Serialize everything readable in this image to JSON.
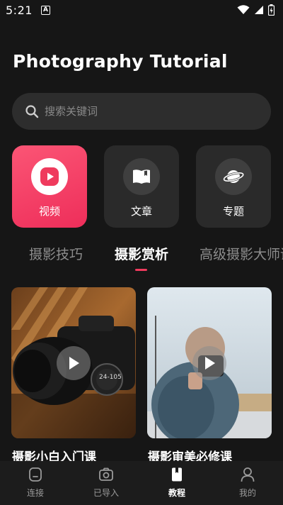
{
  "status": {
    "time": "5:21",
    "notif_letter": "A"
  },
  "header": {
    "title": "Photography Tutorial"
  },
  "search": {
    "placeholder": "搜索关键词"
  },
  "categories": [
    {
      "label": "视频",
      "icon": "play-circle-icon",
      "active": true
    },
    {
      "label": "文章",
      "icon": "book-icon",
      "active": false
    },
    {
      "label": "专题",
      "icon": "planet-icon",
      "active": false
    }
  ],
  "tabs": [
    {
      "label": "摄影技巧",
      "active": false
    },
    {
      "label": "摄影赏析",
      "active": true
    },
    {
      "label": "高级摄影大师课",
      "active": false
    }
  ],
  "cards": [
    {
      "title": "摄影小白入门课",
      "lens_text": "24-105"
    },
    {
      "title": "摄影审美必修课"
    }
  ],
  "bottom_nav": [
    {
      "label": "连接",
      "icon": "device-icon",
      "active": false
    },
    {
      "label": "已导入",
      "icon": "camera-icon",
      "active": false
    },
    {
      "label": "教程",
      "icon": "bookmark-book-icon",
      "active": true
    },
    {
      "label": "我的",
      "icon": "person-icon",
      "active": false
    }
  ],
  "colors": {
    "accent": "#ef3a5d",
    "background": "#161616",
    "surface": "#2a2a2a"
  }
}
